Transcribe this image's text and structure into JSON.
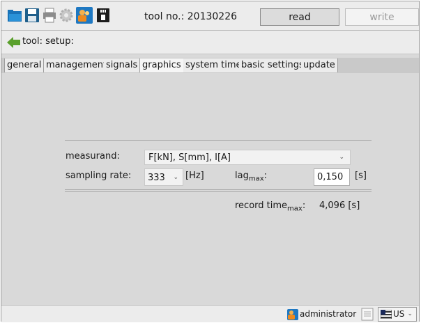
{
  "toolbar": {
    "icons": [
      "folder-open-icon",
      "save-icon",
      "print-icon",
      "settings-gear-icon",
      "user-group-icon",
      "sd-card-icon"
    ],
    "tool_no": "tool no.: 20130226",
    "read_label": "read",
    "write_label": "write"
  },
  "breadcrumb": {
    "label": "tool: setup:"
  },
  "tabs": [
    {
      "label": "general",
      "active": false
    },
    {
      "label": "management",
      "active": false
    },
    {
      "label": "signals",
      "active": false
    },
    {
      "label": "graphics",
      "active": true
    },
    {
      "label": "system time",
      "active": false
    },
    {
      "label": "basic settings",
      "active": false
    },
    {
      "label": "update",
      "active": false
    }
  ],
  "graphics": {
    "measurand_label": "measurand:",
    "measurand_value": "F[kN], S[mm], I[A]",
    "sampling_label": "sampling rate:",
    "sampling_value": "333",
    "sampling_unit": "[Hz]",
    "lag_label": "lag",
    "lag_sub": "max",
    "lag_colon": ":",
    "lag_value": "0,150",
    "lag_unit": "[s]",
    "record_label": "record time",
    "record_sub": "max",
    "record_colon": ":",
    "record_value": "4,096 [s]"
  },
  "status": {
    "user": "administrator",
    "locale": "US"
  },
  "colors": {
    "accent_green": "#5aa02c",
    "accent_blue": "#2a7fc0"
  }
}
